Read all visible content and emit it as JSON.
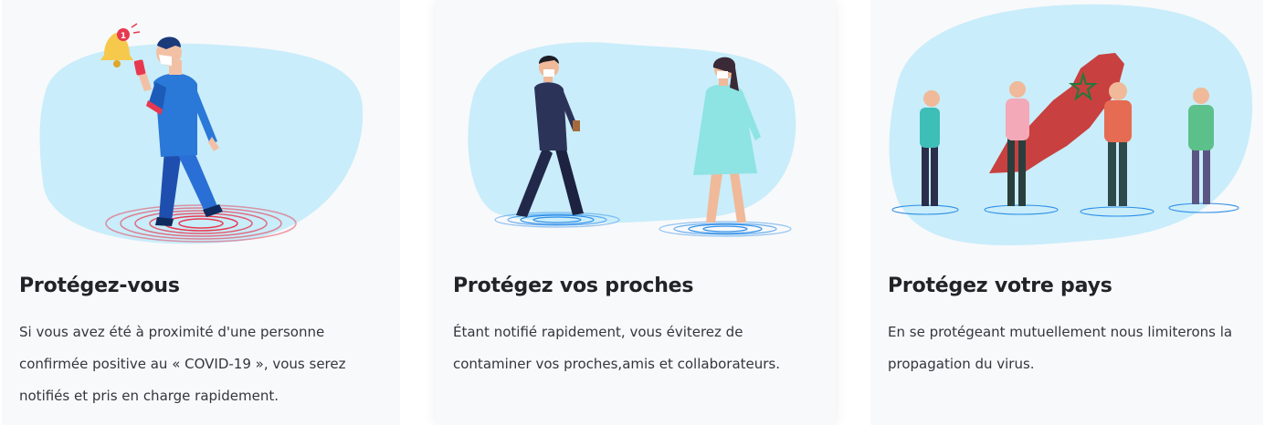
{
  "cards": [
    {
      "title": "Protégez-vous",
      "text": "Si vous avez été à proximité d'une personne confirmée positive au « COVID-19 », vous serez notifiés et pris en charge rapidement.",
      "illustration": "person-with-phone-notification",
      "badge_count": "1"
    },
    {
      "title": "Protégez vos proches",
      "text": "Étant notifié rapidement, vous éviterez de contaminer vos proches,amis et collaborateurs.",
      "illustration": "two-people-with-masks"
    },
    {
      "title": "Protégez votre pays",
      "text": "En se protégeant mutuellement nous limiterons la propagation du virus.",
      "illustration": "people-with-morocco-map"
    }
  ],
  "colors": {
    "blob": "#c9edfa",
    "card_background": "#f8f9fb",
    "title": "#222326",
    "text": "#33363b",
    "alert_rings": "#e8384f",
    "safe_rings": "#2c8ee8",
    "map": "#c8403f",
    "bell": "#f6c94c"
  }
}
